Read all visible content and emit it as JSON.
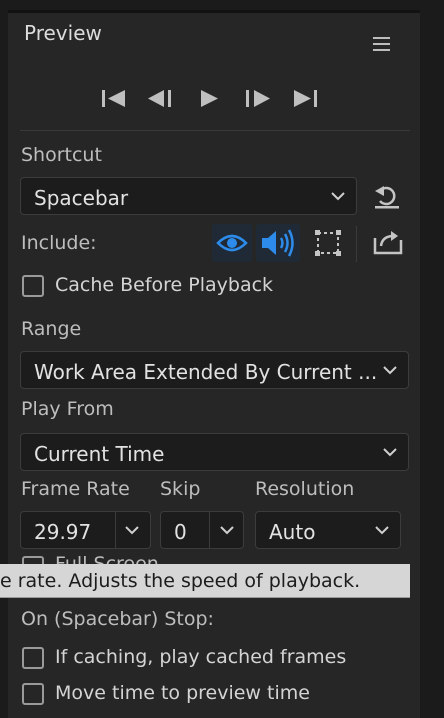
{
  "panel": {
    "title": "Preview",
    "menu_icon": "hamburger-menu-icon"
  },
  "transport": {
    "first_frame_icon": "skip-to-first-frame-icon",
    "previous_frame_icon": "step-back-icon",
    "play_icon": "play-icon",
    "next_frame_icon": "step-forward-icon",
    "last_frame_icon": "skip-to-last-frame-icon"
  },
  "shortcut": {
    "label": "Shortcut",
    "value": "Spacebar",
    "reset_icon": "reset-shortcut-icon"
  },
  "include": {
    "label": "Include:",
    "video_icon": "eye-icon",
    "audio_icon": "speaker-icon",
    "overlays_icon": "overlays-icon",
    "export_icon": "export-icon",
    "active_color": "#2d8ceb"
  },
  "cache_before_playback": {
    "label": "Cache Before Playback",
    "checked": false
  },
  "range": {
    "label": "Range",
    "value": "Work Area Extended By Current ..."
  },
  "play_from": {
    "label": "Play From",
    "value": "Current Time"
  },
  "frame_rate": {
    "label": "Frame Rate",
    "value": "29.97"
  },
  "skip": {
    "label": "Skip",
    "value": "0"
  },
  "resolution": {
    "label": "Resolution",
    "value": "Auto"
  },
  "full_screen": {
    "label": "Full Screen",
    "checked": false
  },
  "tooltip": {
    "text": "e rate. Adjusts the speed of playback."
  },
  "on_stop": {
    "label": "On (Spacebar) Stop:",
    "options": [
      {
        "label": "If caching, play cached frames",
        "checked": false
      },
      {
        "label": "Move time to preview time",
        "checked": false
      }
    ]
  }
}
